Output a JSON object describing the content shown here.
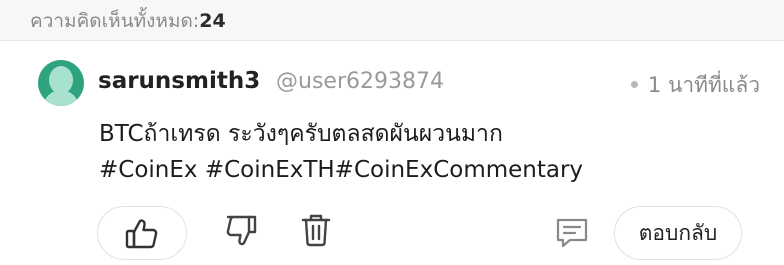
{
  "header": {
    "total_label": "ความคิดเห็นทั้งหมด:",
    "total_count": "24"
  },
  "comment": {
    "username": "sarunsmith3",
    "handle": "@user6293874",
    "time": "1 นาทีที่แล้ว",
    "lines": [
      "BTCถ้าเทรด ระวังๆครับตลสดผันผวนมาก",
      "#CoinEx #CoinExTH#CoinExCommentary"
    ]
  },
  "actions": {
    "reply_label": "ตอบกลับ",
    "icons": [
      "thumbs-up-icon",
      "thumbs-down-icon",
      "trash-icon",
      "comment-icon"
    ]
  },
  "colors": {
    "avatar_bg": "#2fa37f",
    "avatar_fg": "#a8e2cf"
  }
}
